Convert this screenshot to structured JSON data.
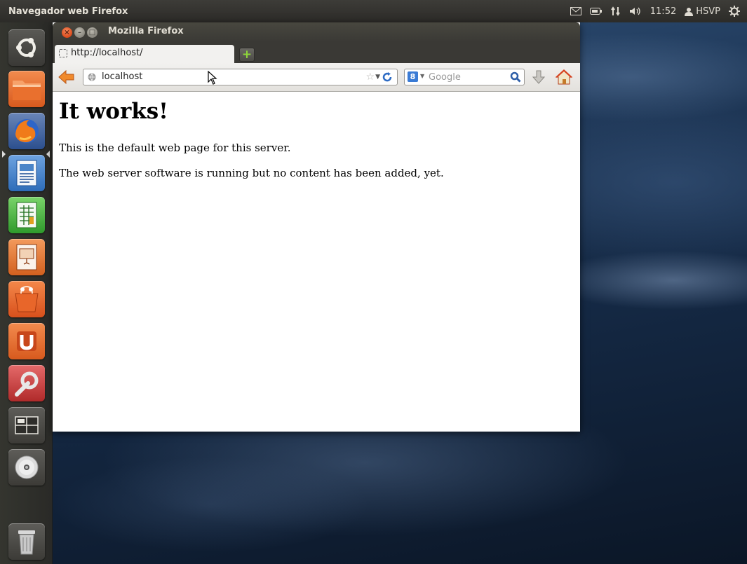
{
  "panel": {
    "app_title": "Navegador web Firefox",
    "clock": "11:52",
    "user_name": "HSVP",
    "icons": [
      "mail-icon",
      "battery-icon",
      "network-icon",
      "volume-icon",
      "user-icon",
      "session-gear-icon"
    ]
  },
  "launcher": {
    "items": [
      {
        "name": "dash-home"
      },
      {
        "name": "files"
      },
      {
        "name": "firefox",
        "active": true
      },
      {
        "name": "libreoffice-writer"
      },
      {
        "name": "libreoffice-calc"
      },
      {
        "name": "libreoffice-impress"
      },
      {
        "name": "ubuntu-software-center"
      },
      {
        "name": "ubuntu-one"
      },
      {
        "name": "system-settings"
      },
      {
        "name": "workspace-switcher"
      },
      {
        "name": "cd-dvd-drive"
      },
      {
        "name": "trash"
      }
    ]
  },
  "window": {
    "title": "Mozilla Firefox",
    "tab_title": "http://localhost/",
    "new_tab_label": "+",
    "url": "localhost",
    "search_placeholder": "Google",
    "search_engine_label": "8"
  },
  "page": {
    "heading": "It works!",
    "paragraphs": [
      "This is the default web page for this server.",
      "The web server software is running but no content has been added, yet."
    ]
  },
  "colors": {
    "accent_orange": "#dd4814",
    "panel_bg": "#3c3b37",
    "launcher_bg": "#2f2f2c"
  }
}
